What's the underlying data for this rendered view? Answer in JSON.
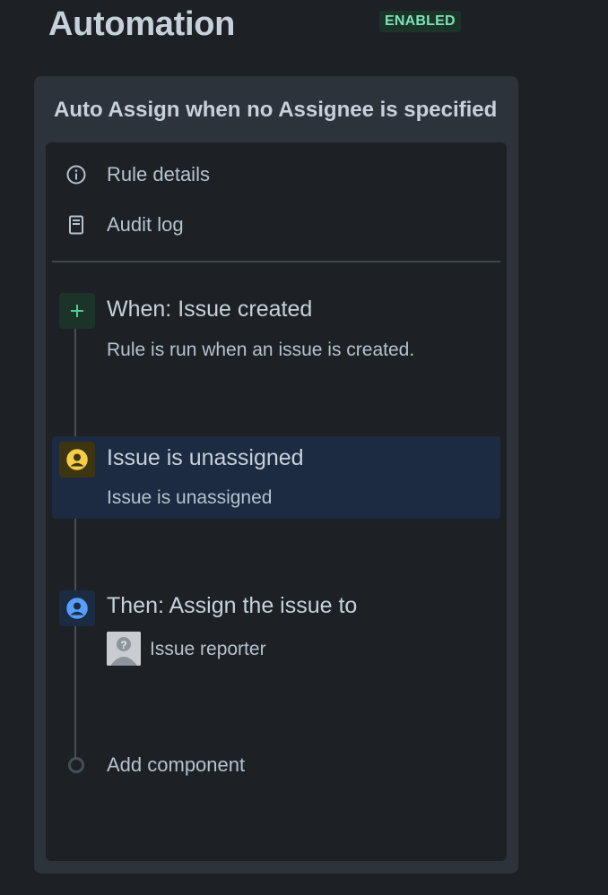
{
  "header": {
    "title": "Automation",
    "status": "ENABLED"
  },
  "rule": {
    "name": "Auto Assign when no Assignee is specified"
  },
  "nav": {
    "rule_details": "Rule details",
    "audit_log": "Audit log"
  },
  "steps": {
    "trigger": {
      "title": "When: Issue created",
      "desc": "Rule is run when an issue is created.",
      "icon": "plus-icon",
      "color": "#4bce97"
    },
    "condition": {
      "title": "Issue is unassigned",
      "desc": "Issue is unassigned",
      "icon": "user-circle-icon",
      "color": "#f5cd47"
    },
    "action": {
      "title": "Then: Assign the issue to",
      "assignee": "Issue reporter",
      "icon": "user-circle-icon",
      "color": "#579dff"
    }
  },
  "add_component": "Add component",
  "colors": {
    "background": "#1d2125",
    "panel": "#2c333a",
    "selected": "#1c2b41",
    "badge_bg": "#1c3329",
    "badge_text": "#7ee2b8"
  }
}
